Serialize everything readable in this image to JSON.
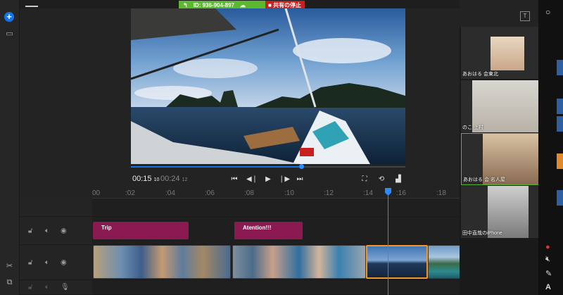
{
  "share": {
    "meeting_id": "ID: 936-904-897",
    "stop_label": "共有の停止"
  },
  "monitor": {
    "current_time": "00:15",
    "current_frames": "10",
    "total_time": "00:24",
    "total_frames": "12",
    "progress": 0.62
  },
  "ruler": {
    "ticks": [
      "00",
      ":02",
      ":04",
      ":06",
      ":08",
      ":10",
      ":12",
      ":14",
      ":16",
      ":18"
    ]
  },
  "titles": [
    {
      "label": "Trip"
    },
    {
      "label": "Atention!!!"
    }
  ],
  "participants": [
    {
      "name": "あおはる 会東北"
    },
    {
      "name": "のこ 上村"
    },
    {
      "name": "あおはる 会 名人屋"
    },
    {
      "name": "田中直哉のiPhone"
    }
  ],
  "topright_icon": "T",
  "right_rail_label": "bell",
  "right_rail_text": "A",
  "colors": {
    "accent": "#1473e6",
    "share_green": "#5cb82e",
    "share_red": "#c8201e",
    "title_clip": "#8c1a52",
    "selection": "#f0962c"
  }
}
